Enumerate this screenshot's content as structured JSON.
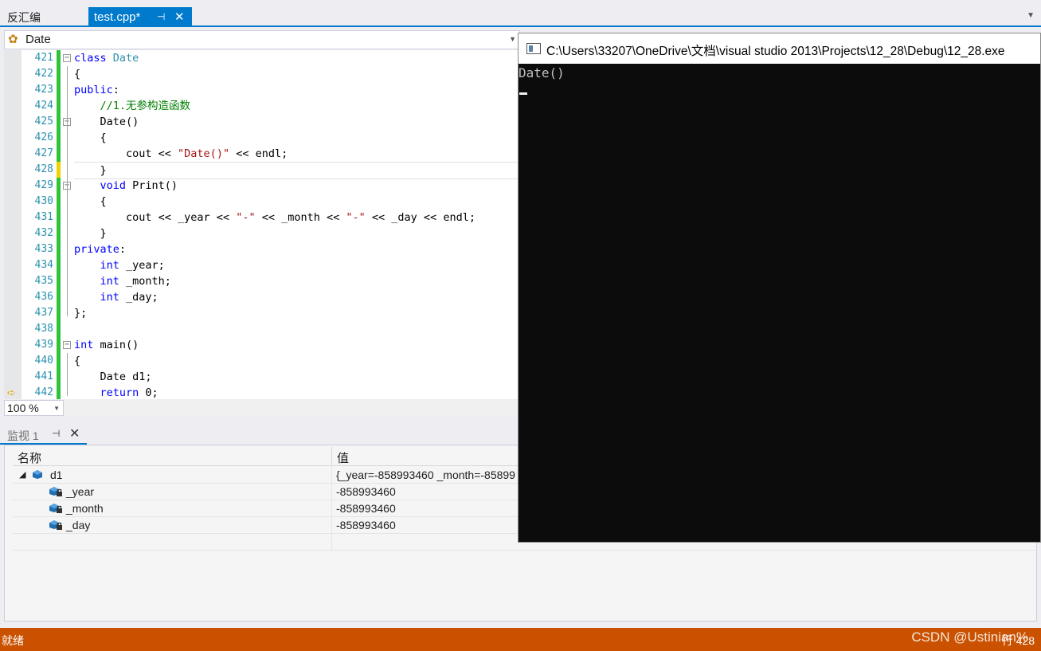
{
  "tabs": {
    "inactive_label": "反汇编",
    "active_label": "test.cpp*",
    "pin_icon": "pin-icon",
    "close_icon": "close-icon"
  },
  "navbar": {
    "scope": "Date",
    "icon": "class-icon"
  },
  "editor": {
    "lines": [
      {
        "num": "421",
        "fold": "−",
        "tokens": [
          [
            "kw",
            "class"
          ],
          [
            "",
            ""
          ],
          [
            "ty",
            " Date"
          ]
        ]
      },
      {
        "num": "422",
        "fold": "",
        "tokens": [
          [
            "",
            "{"
          ]
        ]
      },
      {
        "num": "423",
        "fold": "",
        "tokens": [
          [
            "kw",
            "public"
          ],
          [
            "",
            ":"
          ]
        ]
      },
      {
        "num": "424",
        "fold": "",
        "tokens": [
          [
            "",
            "    "
          ],
          [
            "cm",
            "//1.无参构造函数"
          ]
        ]
      },
      {
        "num": "425",
        "fold": "−",
        "tokens": [
          [
            "",
            "    Date()"
          ]
        ]
      },
      {
        "num": "426",
        "fold": "",
        "tokens": [
          [
            "",
            "    {"
          ]
        ]
      },
      {
        "num": "427",
        "fold": "",
        "tokens": [
          [
            "",
            "        cout << "
          ],
          [
            "st",
            "\"Date()\""
          ],
          [
            "",
            " << endl;"
          ]
        ]
      },
      {
        "num": "428",
        "fold": "",
        "tokens": [
          [
            "",
            "    }"
          ]
        ]
      },
      {
        "num": "429",
        "fold": "−",
        "tokens": [
          [
            "",
            "    "
          ],
          [
            "kw",
            "void"
          ],
          [
            "",
            " Print()"
          ]
        ]
      },
      {
        "num": "430",
        "fold": "",
        "tokens": [
          [
            "",
            "    {"
          ]
        ]
      },
      {
        "num": "431",
        "fold": "",
        "tokens": [
          [
            "",
            "        cout << _year << "
          ],
          [
            "st",
            "\"-\""
          ],
          [
            "",
            " << _month << "
          ],
          [
            "st",
            "\"-\""
          ],
          [
            "",
            " << _day << endl;"
          ]
        ]
      },
      {
        "num": "432",
        "fold": "",
        "tokens": [
          [
            "",
            "    }"
          ]
        ]
      },
      {
        "num": "433",
        "fold": "",
        "tokens": [
          [
            "kw",
            "private"
          ],
          [
            "",
            ":"
          ]
        ]
      },
      {
        "num": "434",
        "fold": "",
        "tokens": [
          [
            "",
            "    "
          ],
          [
            "kw",
            "int"
          ],
          [
            "",
            " _year;"
          ]
        ]
      },
      {
        "num": "435",
        "fold": "",
        "tokens": [
          [
            "",
            "    "
          ],
          [
            "kw",
            "int"
          ],
          [
            "",
            " _month;"
          ]
        ]
      },
      {
        "num": "436",
        "fold": "",
        "tokens": [
          [
            "",
            "    "
          ],
          [
            "kw",
            "int"
          ],
          [
            "",
            " _day;"
          ]
        ]
      },
      {
        "num": "437",
        "fold": "",
        "tokens": [
          [
            "",
            "};"
          ]
        ]
      },
      {
        "num": "438",
        "fold": "",
        "tokens": [
          [
            "",
            ""
          ]
        ]
      },
      {
        "num": "439",
        "fold": "−",
        "tokens": [
          [
            "kw",
            "int"
          ],
          [
            "",
            " main()"
          ]
        ]
      },
      {
        "num": "440",
        "fold": "",
        "tokens": [
          [
            "",
            "{"
          ]
        ]
      },
      {
        "num": "441",
        "fold": "",
        "tokens": [
          [
            "",
            "    Date d1;"
          ]
        ]
      },
      {
        "num": "442",
        "fold": "",
        "tokens": [
          [
            "",
            "    "
          ],
          [
            "kw",
            "return"
          ],
          [
            "",
            " 0;"
          ]
        ]
      }
    ],
    "current_line": "428",
    "breakpoint_arrow_line": "442",
    "next_statement_icon": "arrow-right-icon"
  },
  "zoom": {
    "value": "100 %"
  },
  "watch": {
    "tab_label": "监视 1",
    "col_name": "名称",
    "col_value": "值",
    "rows": [
      {
        "name": "d1",
        "value": "{_year=-858993460 _month=-85899",
        "expanded": true,
        "level": 0
      },
      {
        "name": "_year",
        "value": "-858993460",
        "level": 1
      },
      {
        "name": "_month",
        "value": "-858993460",
        "level": 1
      },
      {
        "name": "_day",
        "value": "-858993460",
        "level": 1
      }
    ]
  },
  "console": {
    "title": "C:\\Users\\33207\\OneDrive\\文档\\visual studio 2013\\Projects\\12_28\\Debug\\12_28.exe",
    "output": "Date()"
  },
  "statusbar": {
    "ready": "就绪",
    "position": "行 428"
  },
  "watermark": "CSDN @Ustinian%"
}
